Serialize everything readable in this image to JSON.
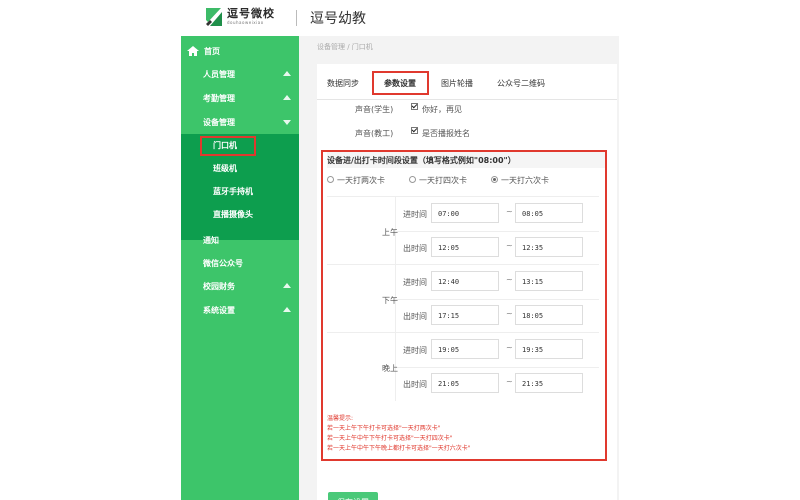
{
  "header": {
    "logo_name": "逗号微校",
    "logo_sub": "douhaoweixiao",
    "title": "逗号幼教"
  },
  "sidebar": {
    "home": "首页",
    "items": [
      {
        "label": "人员管理",
        "arrow": "up"
      },
      {
        "label": "考勤管理",
        "arrow": "up"
      },
      {
        "label": "设备管理",
        "arrow": "down"
      }
    ],
    "sub_items": [
      "门口机",
      "班级机",
      "蓝牙手持机",
      "直播摄像头"
    ],
    "items_after": [
      {
        "label": "通知",
        "arrow": ""
      },
      {
        "label": "微信公众号",
        "arrow": ""
      },
      {
        "label": "校园财务",
        "arrow": "up"
      },
      {
        "label": "系统设置",
        "arrow": "up"
      }
    ]
  },
  "main": {
    "breadcrumb": "设备管理 / 门口机",
    "tabs": [
      "数据同步",
      "参数设置",
      "图片轮播",
      "公众号二维码"
    ],
    "active_tab": "参数设置",
    "sound_rows": [
      {
        "label": "声音(学生)",
        "value": "你好，再见"
      },
      {
        "label": "声音(教工)",
        "value": "是否播报姓名"
      }
    ],
    "time_section": {
      "title": "设备进/出打卡时间段设置（填写格式例如\"08:00\"）",
      "radios": [
        {
          "label": "一天打两次卡",
          "checked": false
        },
        {
          "label": "一天打四次卡",
          "checked": false
        },
        {
          "label": "一天打六次卡",
          "checked": true
        }
      ],
      "groups": [
        {
          "name": "上午",
          "in_label": "进时间",
          "in_from": "07:00",
          "in_to": "08:05",
          "out_label": "出时间",
          "out_from": "12:05",
          "out_to": "12:35"
        },
        {
          "name": "下午",
          "in_label": "进时间",
          "in_from": "12:40",
          "in_to": "13:15",
          "out_label": "出时间",
          "out_from": "17:15",
          "out_to": "18:05"
        },
        {
          "name": "晚上",
          "in_label": "进时间",
          "in_from": "19:05",
          "in_to": "19:35",
          "out_label": "出时间",
          "out_from": "21:05",
          "out_to": "21:35"
        }
      ],
      "tilde": "~",
      "tips_title": "温馨提示:",
      "tips": [
        "若一天上午下午打卡可选择\"一天打两次卡\"",
        "若一天上午中午下午打卡可选择\"一天打四次卡\"",
        "若一天上午中午下午晚上都打卡可选择\"一天打六次卡\""
      ]
    },
    "save_label": "保存设置"
  },
  "colors": {
    "sidebar_bg": "#3dc56a",
    "submenu_bg": "#0d9e4e",
    "highlight": "#e0392e",
    "button": "#4ac979"
  }
}
